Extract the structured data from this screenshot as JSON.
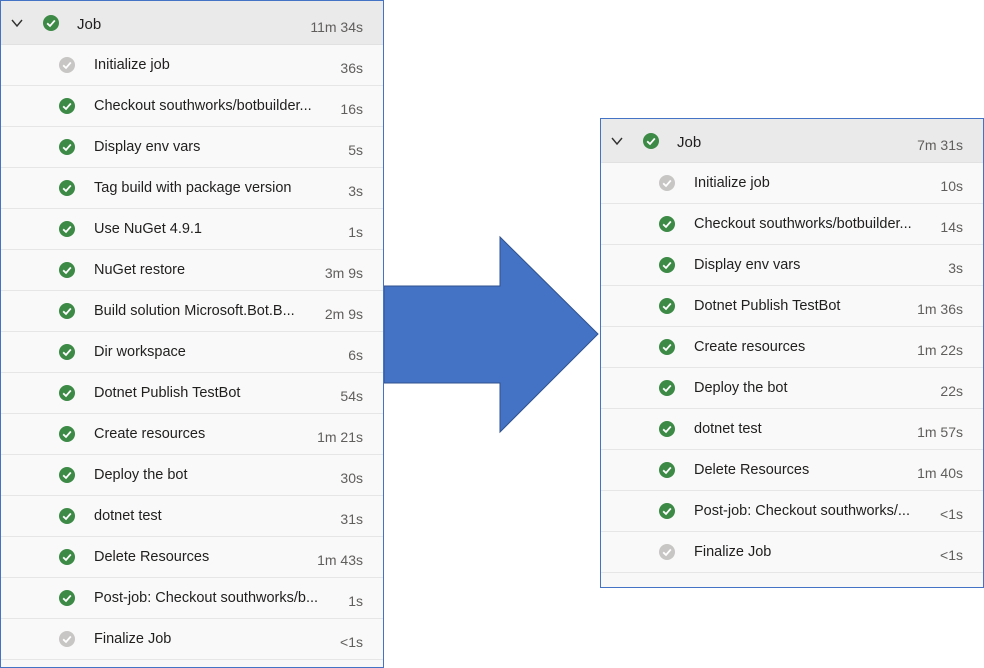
{
  "left_job": {
    "title": "Job",
    "duration": "11m 34s",
    "steps": [
      {
        "name": "Initialize job",
        "duration": "36s",
        "status": "skipped"
      },
      {
        "name": "Checkout southworks/botbuilder...",
        "duration": "16s",
        "status": "success"
      },
      {
        "name": "Display env vars",
        "duration": "5s",
        "status": "success"
      },
      {
        "name": "Tag build with package version",
        "duration": "3s",
        "status": "success"
      },
      {
        "name": "Use NuGet 4.9.1",
        "duration": "1s",
        "status": "success"
      },
      {
        "name": "NuGet restore",
        "duration": "3m 9s",
        "status": "success"
      },
      {
        "name": "Build solution Microsoft.Bot.B...",
        "duration": "2m 9s",
        "status": "success"
      },
      {
        "name": "Dir workspace",
        "duration": "6s",
        "status": "success"
      },
      {
        "name": "Dotnet Publish TestBot",
        "duration": "54s",
        "status": "success"
      },
      {
        "name": "Create resources",
        "duration": "1m 21s",
        "status": "success"
      },
      {
        "name": "Deploy the bot",
        "duration": "30s",
        "status": "success"
      },
      {
        "name": "dotnet test",
        "duration": "31s",
        "status": "success"
      },
      {
        "name": "Delete Resources",
        "duration": "1m 43s",
        "status": "success"
      },
      {
        "name": "Post-job: Checkout southworks/b...",
        "duration": "1s",
        "status": "success"
      },
      {
        "name": "Finalize Job",
        "duration": "<1s",
        "status": "skipped"
      }
    ]
  },
  "right_job": {
    "title": "Job",
    "duration": "7m 31s",
    "steps": [
      {
        "name": "Initialize job",
        "duration": "10s",
        "status": "skipped"
      },
      {
        "name": "Checkout southworks/botbuilder...",
        "duration": "14s",
        "status": "success"
      },
      {
        "name": "Display env vars",
        "duration": "3s",
        "status": "success"
      },
      {
        "name": "Dotnet Publish TestBot",
        "duration": "1m 36s",
        "status": "success"
      },
      {
        "name": "Create resources",
        "duration": "1m 22s",
        "status": "success"
      },
      {
        "name": "Deploy the bot",
        "duration": "22s",
        "status": "success"
      },
      {
        "name": "dotnet test",
        "duration": "1m 57s",
        "status": "success"
      },
      {
        "name": "Delete Resources",
        "duration": "1m 40s",
        "status": "success"
      },
      {
        "name": "Post-job: Checkout southworks/...",
        "duration": "<1s",
        "status": "success"
      },
      {
        "name": "Finalize Job",
        "duration": "<1s",
        "status": "skipped"
      }
    ]
  },
  "colors": {
    "success": "#3c8a46",
    "skipped": "#c8c6c4",
    "arrow": "#4472c4",
    "border": "#4472c4"
  },
  "icons": {
    "collapse": "chevron-down-icon",
    "success": "check-circle-icon",
    "skipped": "check-circle-gray-icon",
    "arrow": "right-arrow-icon"
  }
}
